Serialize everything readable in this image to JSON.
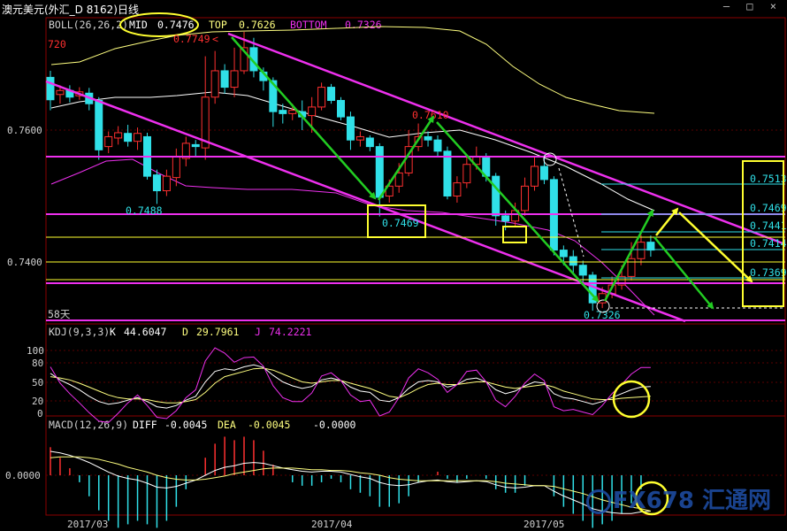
{
  "header": {
    "title": "澳元美元(外汇_D 8162)日线",
    "window_controls": [
      "–",
      "□",
      "×"
    ]
  },
  "indicators": {
    "boll": {
      "label": "BOLL(26,26,2)",
      "mid_label": "MID",
      "mid": "0.7476",
      "top_label": "TOP",
      "top": "0.7626",
      "bottom_label": "BOTTOM",
      "bottom": "0.7326"
    },
    "kdj": {
      "label": "KDJ(9,3,3)",
      "k_label": "K",
      "k": "44.6047",
      "d_label": "D",
      "d": "29.7961",
      "j_label": "J",
      "j": "74.2221"
    },
    "macd": {
      "label": "MACD(12,26,9)",
      "diff_label": "DIFF",
      "diff": "-0.0045",
      "dea_label": "DEA",
      "dea": "-0.0045",
      "macd": "-0.0000"
    }
  },
  "annotations": {
    "high_left": "720",
    "peak": "0.7749",
    "low_left": "0.7488",
    "box_low": "0.7469",
    "mid_high": "0.7610",
    "low_right": "0.7326",
    "days": "58天"
  },
  "colors": {
    "background": "#000000",
    "up": "#ff3030",
    "down": "#30e0e8",
    "channel": "#ee30ee",
    "level_yellow": "#ffff30",
    "arrow_green": "#22cc22",
    "grid": "#5a0000",
    "axis": "#8b0000",
    "text": "#d0d0d0",
    "k_line": "#ffffff",
    "d_line": "#ffff80",
    "j_line": "#ee30ee",
    "boll_mid": "#ffffff",
    "boll_top": "#ffff80",
    "boll_bottom": "#ee30ee"
  },
  "watermark": "FX678 汇通网",
  "chart_data": {
    "type": "candlestick",
    "x_labels": [
      "2017/03",
      "2017/04",
      "2017/05"
    ],
    "price_ticks": [
      "0.7600",
      "0.7400"
    ],
    "kdj_ticks": [
      "100",
      "80",
      "50",
      "20",
      "0"
    ],
    "macd_ticks": [
      "0.0000"
    ],
    "level_lines": [
      "0.7513",
      "0.7469",
      "0.7441",
      "0.7414",
      "0.7369"
    ],
    "ylim": [
      0.728,
      0.773
    ],
    "candles": [
      {
        "o": 0.768,
        "c": 0.7646,
        "h": 0.769,
        "l": 0.763
      },
      {
        "o": 0.7654,
        "c": 0.766,
        "h": 0.7668,
        "l": 0.764
      },
      {
        "o": 0.766,
        "c": 0.765,
        "h": 0.7668,
        "l": 0.7642
      },
      {
        "o": 0.7652,
        "c": 0.7658,
        "h": 0.7665,
        "l": 0.7646
      },
      {
        "o": 0.7656,
        "c": 0.764,
        "h": 0.7664,
        "l": 0.763
      },
      {
        "o": 0.7645,
        "c": 0.757,
        "h": 0.765,
        "l": 0.7555
      },
      {
        "o": 0.7575,
        "c": 0.759,
        "h": 0.7598,
        "l": 0.7565
      },
      {
        "o": 0.7588,
        "c": 0.7596,
        "h": 0.7606,
        "l": 0.7578
      },
      {
        "o": 0.7595,
        "c": 0.7583,
        "h": 0.7608,
        "l": 0.7575
      },
      {
        "o": 0.7583,
        "c": 0.7595,
        "h": 0.7604,
        "l": 0.757
      },
      {
        "o": 0.759,
        "c": 0.753,
        "h": 0.7596,
        "l": 0.7525
      },
      {
        "o": 0.7532,
        "c": 0.7508,
        "h": 0.754,
        "l": 0.7488
      },
      {
        "o": 0.7508,
        "c": 0.753,
        "h": 0.754,
        "l": 0.75
      },
      {
        "o": 0.7528,
        "c": 0.756,
        "h": 0.7572,
        "l": 0.7515
      },
      {
        "o": 0.7557,
        "c": 0.758,
        "h": 0.759,
        "l": 0.7545
      },
      {
        "o": 0.7578,
        "c": 0.7575,
        "h": 0.7585,
        "l": 0.756
      },
      {
        "o": 0.7573,
        "c": 0.765,
        "h": 0.7712,
        "l": 0.7555
      },
      {
        "o": 0.765,
        "c": 0.769,
        "h": 0.772,
        "l": 0.764
      },
      {
        "o": 0.769,
        "c": 0.7665,
        "h": 0.77,
        "l": 0.7655
      },
      {
        "o": 0.7665,
        "c": 0.769,
        "h": 0.7725,
        "l": 0.765
      },
      {
        "o": 0.769,
        "c": 0.7725,
        "h": 0.7749,
        "l": 0.7685
      },
      {
        "o": 0.7725,
        "c": 0.769,
        "h": 0.774,
        "l": 0.768
      },
      {
        "o": 0.7688,
        "c": 0.7675,
        "h": 0.7695,
        "l": 0.766
      },
      {
        "o": 0.7675,
        "c": 0.7628,
        "h": 0.768,
        "l": 0.7605
      },
      {
        "o": 0.763,
        "c": 0.7625,
        "h": 0.764,
        "l": 0.761
      },
      {
        "o": 0.7625,
        "c": 0.763,
        "h": 0.764,
        "l": 0.7615
      },
      {
        "o": 0.7628,
        "c": 0.762,
        "h": 0.7645,
        "l": 0.76
      },
      {
        "o": 0.7622,
        "c": 0.7635,
        "h": 0.765,
        "l": 0.7596
      },
      {
        "o": 0.7635,
        "c": 0.7665,
        "h": 0.7672,
        "l": 0.763
      },
      {
        "o": 0.7665,
        "c": 0.7645,
        "h": 0.767,
        "l": 0.764
      },
      {
        "o": 0.7645,
        "c": 0.762,
        "h": 0.765,
        "l": 0.7615
      },
      {
        "o": 0.762,
        "c": 0.7585,
        "h": 0.7628,
        "l": 0.757
      },
      {
        "o": 0.7585,
        "c": 0.759,
        "h": 0.7598,
        "l": 0.7575
      },
      {
        "o": 0.7588,
        "c": 0.7575,
        "h": 0.7592,
        "l": 0.7568
      },
      {
        "o": 0.7575,
        "c": 0.7498,
        "h": 0.758,
        "l": 0.7469
      },
      {
        "o": 0.75,
        "c": 0.7515,
        "h": 0.7525,
        "l": 0.749
      },
      {
        "o": 0.7515,
        "c": 0.7535,
        "h": 0.755,
        "l": 0.7505
      },
      {
        "o": 0.7535,
        "c": 0.7575,
        "h": 0.76,
        "l": 0.753
      },
      {
        "o": 0.7575,
        "c": 0.759,
        "h": 0.761,
        "l": 0.7568
      },
      {
        "o": 0.759,
        "c": 0.7585,
        "h": 0.7598,
        "l": 0.7575
      },
      {
        "o": 0.7585,
        "c": 0.7568,
        "h": 0.7592,
        "l": 0.756
      },
      {
        "o": 0.7568,
        "c": 0.75,
        "h": 0.7575,
        "l": 0.7495
      },
      {
        "o": 0.75,
        "c": 0.752,
        "h": 0.753,
        "l": 0.749
      },
      {
        "o": 0.752,
        "c": 0.7548,
        "h": 0.756,
        "l": 0.7512
      },
      {
        "o": 0.7548,
        "c": 0.756,
        "h": 0.7575,
        "l": 0.754
      },
      {
        "o": 0.756,
        "c": 0.753,
        "h": 0.7565,
        "l": 0.7522
      },
      {
        "o": 0.753,
        "c": 0.747,
        "h": 0.7535,
        "l": 0.7455
      },
      {
        "o": 0.747,
        "c": 0.7462,
        "h": 0.7478,
        "l": 0.7448
      },
      {
        "o": 0.7462,
        "c": 0.7478,
        "h": 0.749,
        "l": 0.7455
      },
      {
        "o": 0.7478,
        "c": 0.7515,
        "h": 0.7528,
        "l": 0.747
      },
      {
        "o": 0.7515,
        "c": 0.7545,
        "h": 0.756,
        "l": 0.7508
      },
      {
        "o": 0.7545,
        "c": 0.7525,
        "h": 0.7562,
        "l": 0.7518
      },
      {
        "o": 0.7525,
        "c": 0.7418,
        "h": 0.753,
        "l": 0.741
      },
      {
        "o": 0.7418,
        "c": 0.7408,
        "h": 0.7425,
        "l": 0.7395
      },
      {
        "o": 0.7408,
        "c": 0.7395,
        "h": 0.7418,
        "l": 0.738
      },
      {
        "o": 0.7395,
        "c": 0.738,
        "h": 0.7402,
        "l": 0.7365
      },
      {
        "o": 0.738,
        "c": 0.7338,
        "h": 0.7385,
        "l": 0.7326
      },
      {
        "o": 0.7338,
        "c": 0.7352,
        "h": 0.7362,
        "l": 0.733
      },
      {
        "o": 0.7352,
        "c": 0.7365,
        "h": 0.7378,
        "l": 0.7345
      },
      {
        "o": 0.7365,
        "c": 0.7378,
        "h": 0.7395,
        "l": 0.7358
      },
      {
        "o": 0.7378,
        "c": 0.7405,
        "h": 0.743,
        "l": 0.7372
      },
      {
        "o": 0.7405,
        "c": 0.743,
        "h": 0.7441,
        "l": 0.7395
      },
      {
        "o": 0.743,
        "c": 0.7418,
        "h": 0.744,
        "l": 0.7408
      }
    ],
    "kdj": {
      "k": [
        65,
        55,
        48,
        40,
        30,
        22,
        18,
        20,
        24,
        28,
        22,
        14,
        12,
        16,
        24,
        30,
        52,
        68,
        72,
        70,
        75,
        78,
        74,
        62,
        52,
        46,
        42,
        45,
        55,
        58,
        54,
        44,
        38,
        36,
        24,
        22,
        28,
        42,
        52,
        54,
        52,
        44,
        48,
        56,
        58,
        52,
        40,
        34,
        38,
        46,
        52,
        50,
        34,
        28,
        26,
        22,
        18,
        22,
        28,
        34,
        40,
        44,
        45
      ],
      "d": [
        60,
        58,
        55,
        50,
        44,
        38,
        32,
        28,
        26,
        26,
        25,
        22,
        20,
        20,
        22,
        25,
        36,
        50,
        60,
        64,
        68,
        72,
        73,
        70,
        64,
        58,
        52,
        50,
        52,
        54,
        54,
        50,
        46,
        42,
        36,
        30,
        28,
        34,
        42,
        48,
        50,
        48,
        48,
        50,
        52,
        52,
        48,
        44,
        42,
        44,
        46,
        48,
        44,
        38,
        34,
        30,
        26,
        25,
        25,
        27,
        28,
        29,
        30
      ],
      "j": [
        75,
        50,
        34,
        20,
        5,
        -8,
        -10,
        4,
        20,
        32,
        16,
        -2,
        -4,
        8,
        28,
        40,
        84,
        104,
        96,
        82,
        89,
        90,
        76,
        46,
        28,
        22,
        22,
        35,
        61,
        66,
        54,
        32,
        22,
        24,
        0,
        6,
        28,
        58,
        72,
        66,
        56,
        36,
        48,
        68,
        70,
        52,
        24,
        14,
        30,
        50,
        64,
        54,
        14,
        8,
        10,
        6,
        2,
        16,
        34,
        48,
        64,
        74,
        74
      ]
    },
    "macd": {
      "diff": [
        0.003,
        0.0028,
        0.0025,
        0.0021,
        0.0016,
        0.001,
        0.0004,
        -0.0001,
        -0.0004,
        -0.0006,
        -0.001,
        -0.0015,
        -0.0016,
        -0.0014,
        -0.001,
        -0.0006,
        0.0,
        0.0006,
        0.001,
        0.0012,
        0.0015,
        0.0016,
        0.0015,
        0.0012,
        0.0009,
        0.0007,
        0.0005,
        0.0004,
        0.0005,
        0.0005,
        0.0004,
        0.0001,
        -0.0002,
        -0.0004,
        -0.0009,
        -0.0012,
        -0.0013,
        -0.0012,
        -0.0009,
        -0.0007,
        -0.0006,
        -0.0008,
        -0.0009,
        -0.0008,
        -0.0007,
        -0.0008,
        -0.0012,
        -0.0015,
        -0.0016,
        -0.0015,
        -0.0013,
        -0.0013,
        -0.002,
        -0.0026,
        -0.0031,
        -0.0036,
        -0.0042,
        -0.0045,
        -0.0047,
        -0.0048,
        -0.0048,
        -0.0046,
        -0.0045
      ],
      "dea": [
        0.0022,
        0.0023,
        0.0023,
        0.0023,
        0.0022,
        0.002,
        0.0017,
        0.0014,
        0.001,
        0.0007,
        0.0004,
        0.0,
        -0.0003,
        -0.0005,
        -0.0006,
        -0.0006,
        -0.0005,
        -0.0003,
        -0.0001,
        0.0002,
        0.0004,
        0.0006,
        0.0008,
        0.0009,
        0.0009,
        0.0009,
        0.0008,
        0.0007,
        0.0007,
        0.0006,
        0.0006,
        0.0005,
        0.0003,
        0.0002,
        0.0,
        -0.0003,
        -0.0005,
        -0.0006,
        -0.0007,
        -0.0007,
        -0.0007,
        -0.0007,
        -0.0007,
        -0.0007,
        -0.0007,
        -0.0007,
        -0.0008,
        -0.001,
        -0.0011,
        -0.0012,
        -0.0013,
        -0.0013,
        -0.0014,
        -0.0017,
        -0.002,
        -0.0023,
        -0.0027,
        -0.0031,
        -0.0034,
        -0.0037,
        -0.004,
        -0.0042,
        -0.0045
      ]
    }
  }
}
